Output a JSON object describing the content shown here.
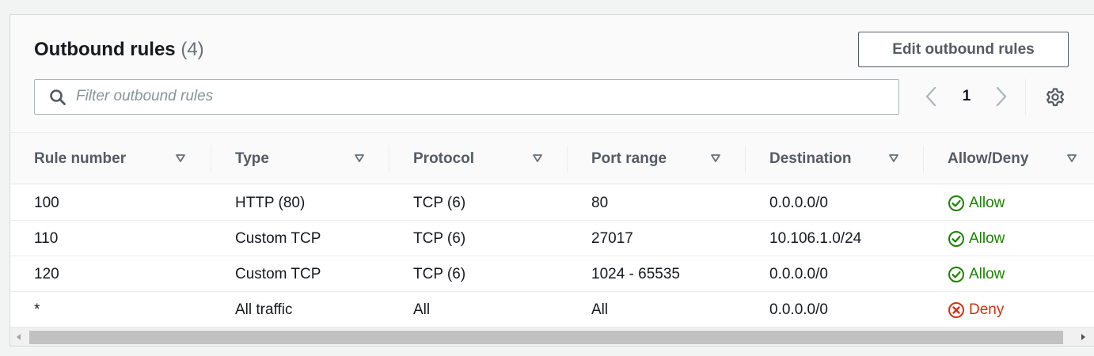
{
  "header": {
    "title": "Outbound rules",
    "count": "(4)",
    "edit_button_label": "Edit outbound rules"
  },
  "filter": {
    "placeholder": "Filter outbound rules",
    "value": ""
  },
  "pagination": {
    "current_page": "1"
  },
  "table": {
    "columns": [
      "Rule number",
      "Type",
      "Protocol",
      "Port range",
      "Destination",
      "Allow/Deny"
    ],
    "rows": [
      {
        "rule_number": "100",
        "type": "HTTP (80)",
        "protocol": "TCP (6)",
        "port_range": "80",
        "destination": "0.0.0.0/0",
        "action": "Allow"
      },
      {
        "rule_number": "110",
        "type": "Custom TCP",
        "protocol": "TCP (6)",
        "port_range": "27017",
        "destination": "10.106.1.0/24",
        "action": "Allow"
      },
      {
        "rule_number": "120",
        "type": "Custom TCP",
        "protocol": "TCP (6)",
        "port_range": "1024 - 65535",
        "destination": "0.0.0.0/0",
        "action": "Allow"
      },
      {
        "rule_number": "*",
        "type": "All traffic",
        "protocol": "All",
        "port_range": "All",
        "destination": "0.0.0.0/0",
        "action": "Deny"
      }
    ]
  },
  "colors": {
    "allow": "#1d8102",
    "deny": "#d13212",
    "header_text": "#545b64",
    "border": "#eaeded"
  },
  "icons": {
    "search": "search-icon",
    "prev": "chevron-left-icon",
    "next": "chevron-right-icon",
    "settings": "gear-icon",
    "sort": "caret-down-icon",
    "allow": "check-circle-icon",
    "deny": "x-circle-icon"
  }
}
